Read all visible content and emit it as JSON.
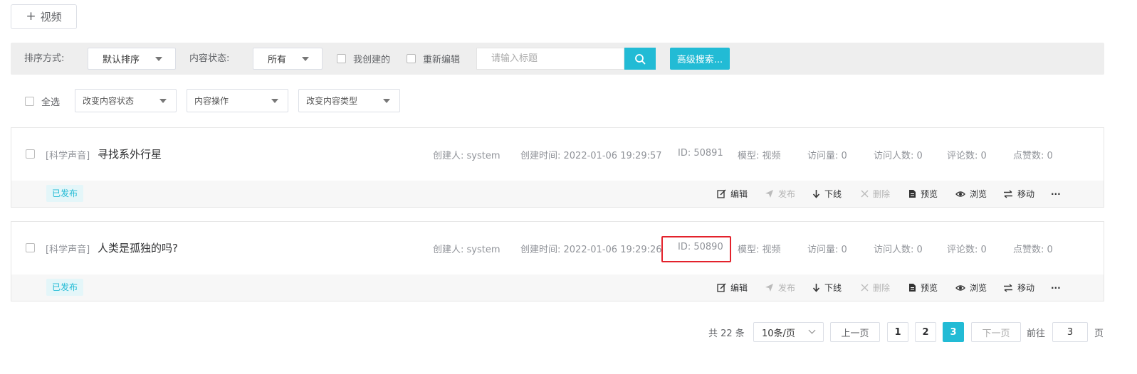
{
  "toolbar": {
    "add_label": "视频"
  },
  "filter": {
    "sort_label": "排序方式:",
    "sort_value": "默认排序",
    "status_label": "内容状态:",
    "status_value": "所有",
    "my_created_label": "我创建的",
    "re_edit_label": "重新编辑",
    "search_placeholder": "请输入标题",
    "advanced_label": "高级搜索..."
  },
  "batch": {
    "select_all_label": "全选",
    "change_status": "改变内容状态",
    "content_ops": "内容操作",
    "change_type": "改变内容类型"
  },
  "actions": {
    "edit": "编辑",
    "publish": "发布",
    "offline": "下线",
    "delete": "删除",
    "preview": "预览",
    "browse": "浏览",
    "move": "移动",
    "more": "···"
  },
  "items": [
    {
      "category": "[科学声音]",
      "title": "寻找系外行星",
      "creator": "创建人: system",
      "created": "创建时间: 2022-01-06 19:29:57",
      "id": "ID: 50891",
      "model": "模型: 视频",
      "visits": "访问量: 0",
      "visitors": "访问人数: 0",
      "comments": "评论数: 0",
      "likes": "点赞数: 0",
      "status": "已发布"
    },
    {
      "category": "[科学声音]",
      "title": "人类是孤独的吗?",
      "creator": "创建人: system",
      "created": "创建时间: 2022-01-06 19:29:26",
      "id": "ID: 50890",
      "model": "模型: 视频",
      "visits": "访问量: 0",
      "visitors": "访问人数: 0",
      "comments": "评论数: 0",
      "likes": "点赞数: 0",
      "status": "已发布"
    }
  ],
  "pagination": {
    "total": "共 22 条",
    "page_size": "10条/页",
    "prev": "上一页",
    "pages": [
      "1",
      "2",
      "3"
    ],
    "next": "下一页",
    "goto_label": "前往",
    "goto_value": "3",
    "page_suffix": "页"
  },
  "colors": {
    "accent": "#22bbd5",
    "highlight": "#e3222c"
  }
}
